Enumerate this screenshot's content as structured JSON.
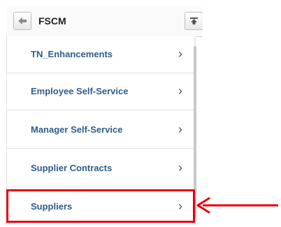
{
  "header": {
    "title": "FSCM"
  },
  "menu": {
    "items": [
      {
        "label": "TN_Enhancements"
      },
      {
        "label": "Employee Self-Service"
      },
      {
        "label": "Manager Self-Service"
      },
      {
        "label": "Supplier Contracts"
      },
      {
        "label": "Suppliers"
      }
    ]
  },
  "colors": {
    "link": "#2e5d8c",
    "highlight": "#e8000b"
  }
}
